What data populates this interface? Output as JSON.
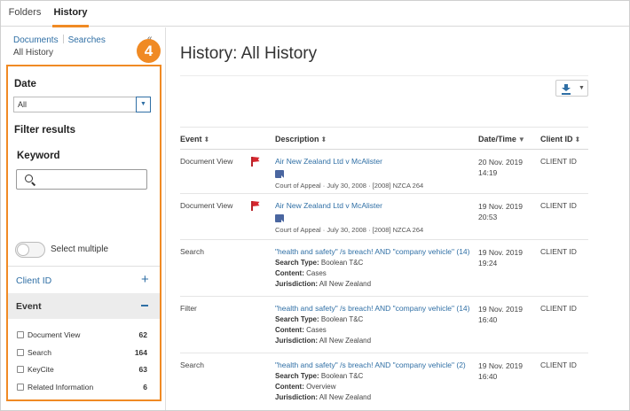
{
  "tabs": [
    {
      "label": "Folders"
    },
    {
      "label": "History"
    }
  ],
  "sidebar": {
    "crumb_documents": "Documents",
    "crumb_searches": "Searches",
    "crumb_current": "All History",
    "badge": "4",
    "date_label": "Date",
    "date_value": "All",
    "filter_title": "Filter results",
    "keyword_label": "Keyword",
    "select_multiple": "Select multiple",
    "client_id_label": "Client ID",
    "event_label": "Event",
    "facets": [
      {
        "label": "Document View",
        "count": "62"
      },
      {
        "label": "Search",
        "count": "164"
      },
      {
        "label": "KeyCite",
        "count": "63"
      },
      {
        "label": "Related Information",
        "count": "6"
      }
    ]
  },
  "main": {
    "title": "History: All History",
    "columns": {
      "event": "Event",
      "description": "Description",
      "datetime": "Date/Time",
      "client": "Client ID"
    },
    "rows": [
      {
        "event": "Document View",
        "link": "Air New Zealand Ltd v McAlister",
        "meta": "Court of Appeal · July 30, 2008 · [2008] NZCA 264",
        "date": "20 Nov. 2019",
        "time": "14:19",
        "client": "CLIENT ID"
      },
      {
        "event": "Document View",
        "link": "Air New Zealand Ltd v McAlister",
        "meta": "Court of Appeal · July 30, 2008 · [2008] NZCA 264",
        "date": "19 Nov. 2019",
        "time": "20:53",
        "client": "CLIENT ID"
      },
      {
        "event": "Search",
        "link": "\"health and safety\" /s breach! AND \"company vehicle\" (14)",
        "search_type": "Boolean T&C",
        "content": "Cases",
        "jurisdiction": "All New Zealand",
        "date": "19 Nov. 2019",
        "time": "19:24",
        "client": "CLIENT ID"
      },
      {
        "event": "Filter",
        "link": "\"health and safety\" /s breach! AND \"company vehicle\" (14)",
        "search_type": "Boolean T&C",
        "content": "Cases",
        "jurisdiction": "All New Zealand",
        "date": "19 Nov. 2019",
        "time": "16:40",
        "client": "CLIENT ID"
      },
      {
        "event": "Search",
        "link": "\"health and safety\" /s breach! AND \"company vehicle\" (2)",
        "search_type": "Boolean T&C",
        "content": "Overview",
        "jurisdiction": "All New Zealand",
        "date": "19 Nov. 2019",
        "time": "16:40",
        "client": "CLIENT ID"
      }
    ],
    "labels": {
      "search_type": "Search Type:",
      "content": "Content:",
      "jurisdiction": "Jurisdiction:"
    }
  },
  "colors": {
    "accent": "#f08a24",
    "link": "#2f6fa5",
    "flag": "#d6262e"
  }
}
